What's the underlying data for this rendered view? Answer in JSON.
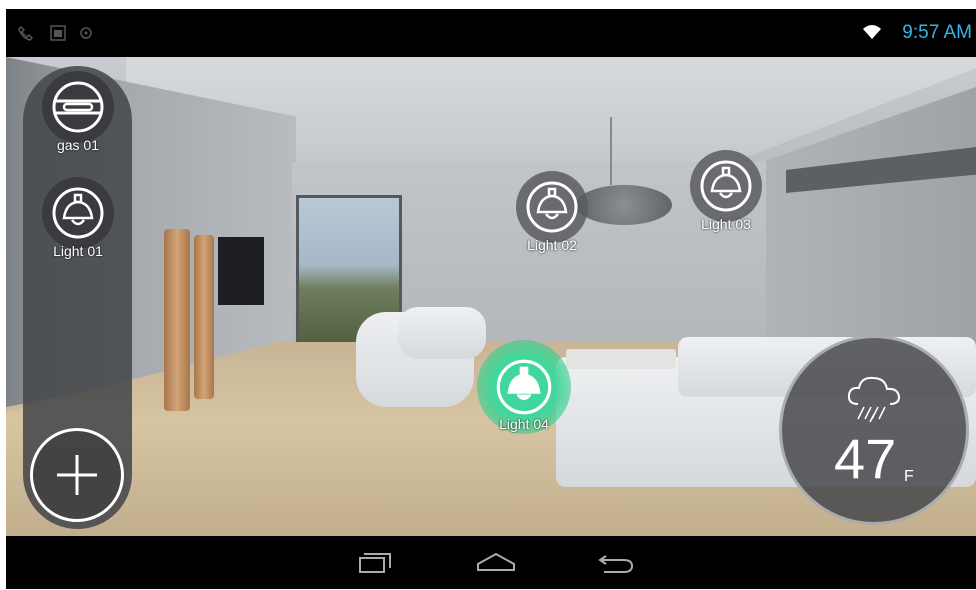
{
  "statusbar": {
    "time": "9:57 AM",
    "icons": [
      "missed-call-icon",
      "image-icon",
      "sync-icon",
      "wifi-icon"
    ]
  },
  "sidebar": {
    "devices": [
      {
        "label": "gas 01",
        "icon": "gas-valve-icon"
      },
      {
        "label": "Light 01",
        "icon": "pendant-lamp-icon"
      }
    ],
    "add_icon": "plus-icon"
  },
  "room_devices": [
    {
      "label": "Light 02",
      "icon": "pendant-lamp-icon",
      "state": "off"
    },
    {
      "label": "Light 03",
      "icon": "pendant-lamp-icon",
      "state": "off"
    },
    {
      "label": "Light 04",
      "icon": "pendant-lamp-icon",
      "state": "on"
    }
  ],
  "weather": {
    "icon": "rain-cloud-icon",
    "temperature": "47",
    "unit": "F"
  },
  "navbar": {
    "icons": [
      "recent-apps-icon",
      "home-icon",
      "back-icon"
    ]
  },
  "colors": {
    "accent_clock": "#33b5e5",
    "active_light": "#2ecc8a",
    "panel": "#46484b"
  }
}
